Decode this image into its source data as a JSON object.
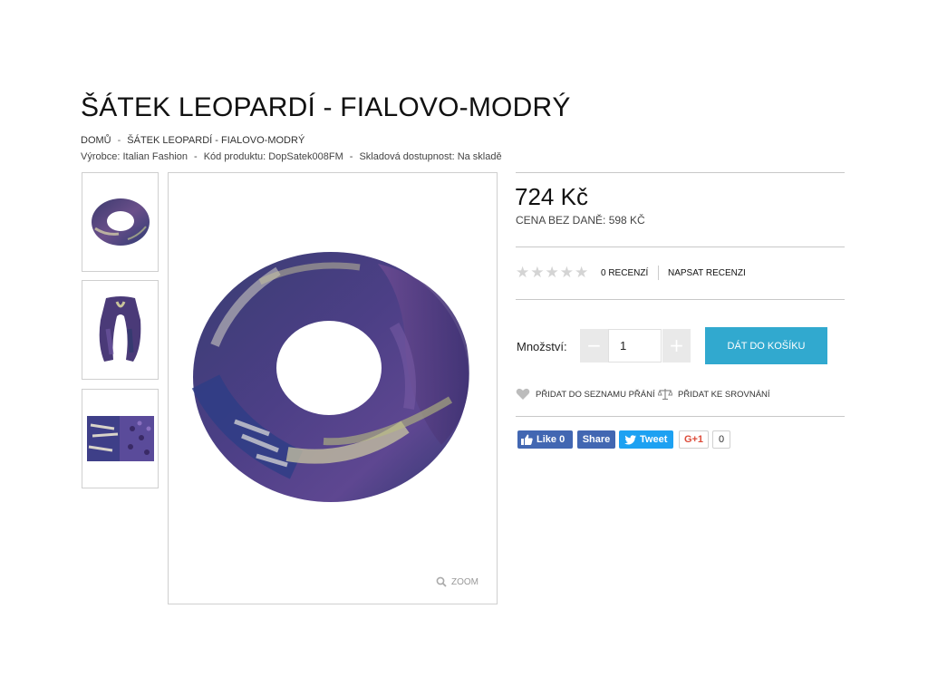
{
  "product": {
    "title": "ŠÁTEK LEOPARDÍ - FIALOVO-MODRÝ",
    "breadcrumb": [
      "DOMŮ",
      "ŠÁTEK LEOPARDÍ - FIALOVO-MODRÝ"
    ],
    "meta": {
      "manufacturer": "Výrobce: Italian Fashion",
      "code": "Kód produktu: DopSatek008FM",
      "stock": "Skladová dostupnost: Na skladě",
      "separator": "-"
    },
    "price": "724 Kč",
    "price_without_vat": "CENA BEZ DANĚ: 598 KČ"
  },
  "gallery": {
    "zoom_label": "ZOOM",
    "thumbnails": [
      "scarf-ring",
      "scarf-draped",
      "scarf-flat"
    ]
  },
  "reviews": {
    "rating": 0,
    "max_rating": 5,
    "count_label": "0 RECENZÍ",
    "write_label": "NAPSAT RECENZI"
  },
  "cart": {
    "quantity_label": "Množství:",
    "quantity": "1",
    "minus": "−",
    "plus": "+",
    "add_label": "DÁT DO KOŠÍKU"
  },
  "actions": {
    "wishlist_label": "PŘIDAT DO SEZNAMU PŘÁNÍ",
    "compare_label": "PŘIDAT KE SROVNÁNÍ"
  },
  "social": {
    "fb_like": "Like 0",
    "fb_share": "Share",
    "tweet": "Tweet",
    "gplus": "G+1",
    "gplus_count": "0"
  },
  "colors": {
    "accent": "#31a9cf",
    "facebook": "#4267b2",
    "twitter": "#1da1f2",
    "google_plus": "#dd4b39"
  }
}
